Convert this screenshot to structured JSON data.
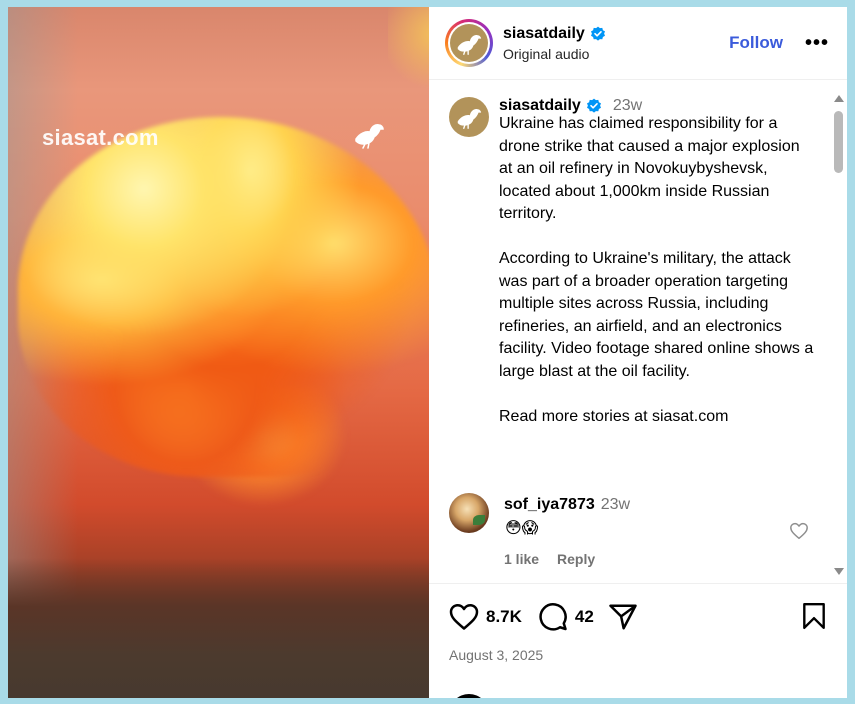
{
  "media": {
    "watermark": "siasat.com",
    "bird_icon": "pigeon-icon"
  },
  "header": {
    "username": "siasatdaily",
    "subtitle": "Original audio",
    "follow_label": "Follow",
    "more_icon": "more-icon",
    "more_label": "•••",
    "verified_icon": "verified-badge-icon"
  },
  "caption": {
    "username": "siasatdaily",
    "time": "23w",
    "text": "Ukraine has claimed responsibility for a drone strike that caused a major explosion at an oil refinery in Novokuybyshevsk, located about 1,000km inside Russian territory.\n\nAccording to Ukraine's military, the attack was part of a broader operation targeting multiple sites across Russia, including refineries, an airfield, and an electronics facility. Video footage shared online shows a large blast at the oil facility.\n\nRead more stories at siasat.com"
  },
  "comments": [
    {
      "username": "sof_iya7873",
      "time": "23w",
      "text": "😳😱",
      "likes_label": "1 like",
      "reply_label": "Reply"
    }
  ],
  "actions": {
    "like_count": "8.7K",
    "comment_count": "42",
    "icons": [
      "heart-icon",
      "comment-icon",
      "share-icon",
      "bookmark-icon"
    ]
  },
  "post": {
    "date": "August 3, 2025"
  },
  "colors": {
    "link": "#3b5bdb",
    "muted": "#737373",
    "verified": "#0095f6"
  }
}
